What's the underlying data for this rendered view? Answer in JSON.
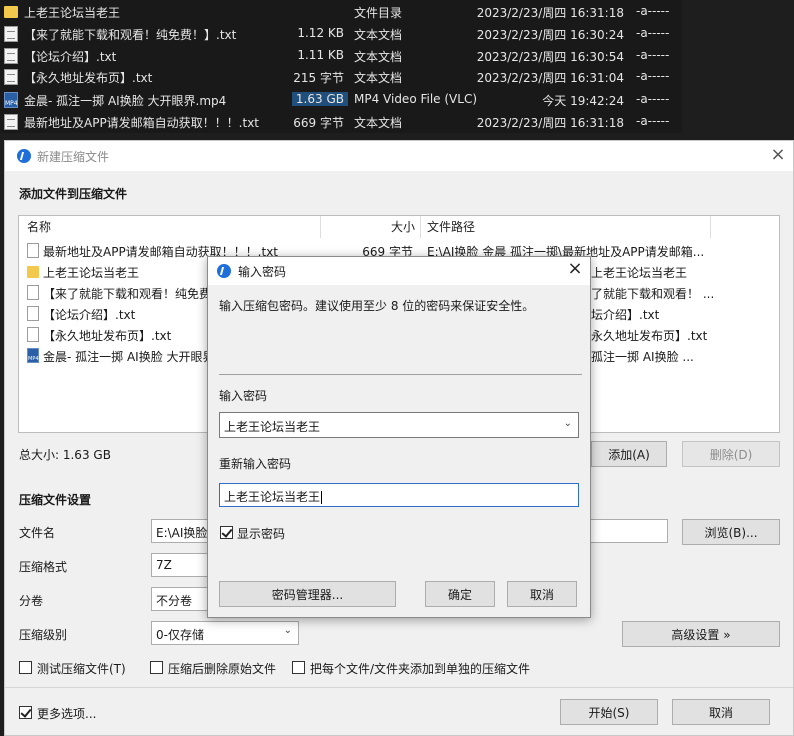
{
  "explorer": {
    "rows": [
      {
        "name": "上老王论坛当老王",
        "size": "",
        "type": "文件目录",
        "date": "2023/2/23/周四 16:31:18",
        "attr": "-a-----",
        "icon": "folder-icon"
      },
      {
        "name": "【来了就能下载和观看！纯免费！】.txt",
        "size": "1.12 KB",
        "type": "文本文档",
        "date": "2023/2/23/周四 16:30:24",
        "attr": "-a-----",
        "icon": "text-file-icon"
      },
      {
        "name": "【论坛介绍】.txt",
        "size": "1.11 KB",
        "type": "文本文档",
        "date": "2023/2/23/周四 16:30:54",
        "attr": "-a-----",
        "icon": "text-file-icon"
      },
      {
        "name": "【永久地址发布页】.txt",
        "size": "215 字节",
        "type": "文本文档",
        "date": "2023/2/23/周四 16:31:04",
        "attr": "-a-----",
        "icon": "text-file-icon"
      },
      {
        "name": "金晨- 孤注一掷 AI换脸 大开眼界.mp4",
        "size": "1.63 GB",
        "type": "MP4 Video File (VLC)",
        "date": "今天 19:42:24",
        "attr": "-a-----",
        "icon": "mp4-file-icon"
      },
      {
        "name": "最新地址及APP请发邮箱自动获取！！！.txt",
        "size": "669 字节",
        "type": "文本文档",
        "date": "2023/2/23/周四 16:31:18",
        "attr": "-a-----",
        "icon": "text-file-icon"
      }
    ],
    "mp4_label": "MP4"
  },
  "main_dialog": {
    "title": "新建压缩文件",
    "add_section_title": "添加文件到压缩文件",
    "columns": {
      "name": "名称",
      "size": "大小",
      "path": "文件路径"
    },
    "files": [
      {
        "name": "最新地址及APP请发邮箱自动获取！！！.txt",
        "size": "669 字节",
        "path": "E:\\AI换脸 金晨 孤注一掷\\最新地址及APP请发邮箱..."
      },
      {
        "name": "上老王论坛当老王",
        "size": "",
        "path": "E:\\AI换脸 金晨 孤注一掷\\上老王论坛当老王"
      },
      {
        "name": "【来了就能下载和观看！纯免费！】.txt",
        "size": "",
        "path": "E:\\AI换脸 金晨 孤注一掷\\【来了就能下载和观看！..."
      },
      {
        "name": "【论坛介绍】.txt",
        "size": "",
        "path": "E:\\AI换脸 金晨 孤注一掷\\【论坛介绍】.txt"
      },
      {
        "name": "【永久地址发布页】.txt",
        "size": "",
        "path": "E:\\AI换脸 金晨 孤注一掷\\【永久地址发布页】.txt"
      },
      {
        "name": "金晨- 孤注一掷 AI换脸 大开眼界.mp4",
        "size": "",
        "path": "E:\\AI换脸 金晨 孤注一掷\\金晨- 孤注一掷 AI换脸 ..."
      }
    ],
    "visible_name_cut": {
      "r1": "最新地址及APP请发邮箱自动获取！！！.txt",
      "r2": "上老王论坛当老王",
      "r3": "【来了就能下载和观看！纯免费",
      "r4": "【论坛介绍】.txt",
      "r5": "【永久地址发布页】.txt",
      "r6": "金晨- 孤注一掷 AI换脸 大开眼界"
    },
    "visible_path_cut": {
      "r1": "E:\\AI换脸 金晨 孤注一掷\\最新地址及APP请发邮箱...",
      "r2": "上老王论坛当老王",
      "r3": "了就能下载和观看！ ...",
      "r4": "坛介绍】.txt",
      "r5": "永久地址发布页】.txt",
      "r6": "孤注一掷 AI换脸 ..."
    },
    "total_size": "总大小: 1.63 GB",
    "add_button": "添加(A)",
    "delete_button": "删除(D)",
    "settings_section_title": "压缩文件设置",
    "filename_label": "文件名",
    "filename_value": "E:\\AI换脸",
    "browse_button": "浏览(B)...",
    "format_label": "压缩格式",
    "format_value": "7Z",
    "split_label": "分卷",
    "split_value": "不分卷",
    "level_label": "压缩级别",
    "level_value": "0-仅存储",
    "advanced_button": "高级设置 »",
    "test_checkbox": "测试压缩文件(T)",
    "delete_after_checkbox": "压缩后删除原始文件",
    "each_separate_checkbox": "把每个文件/文件夹添加到单独的压缩文件",
    "more_options_checkbox": "更多选项...",
    "start_button": "开始(S)",
    "cancel_button": "取消"
  },
  "password_dialog": {
    "title": "输入密码",
    "hint": "输入压缩包密码。建议使用至少 8 位的密码来保证安全性。",
    "password_label": "输入密码",
    "password_value": "上老王论坛当老王",
    "confirm_label": "重新输入密码",
    "confirm_value": "上老王论坛当老王",
    "show_password": "显示密码",
    "manager_button": "密码管理器...",
    "ok_button": "确定",
    "cancel_button": "取消"
  }
}
